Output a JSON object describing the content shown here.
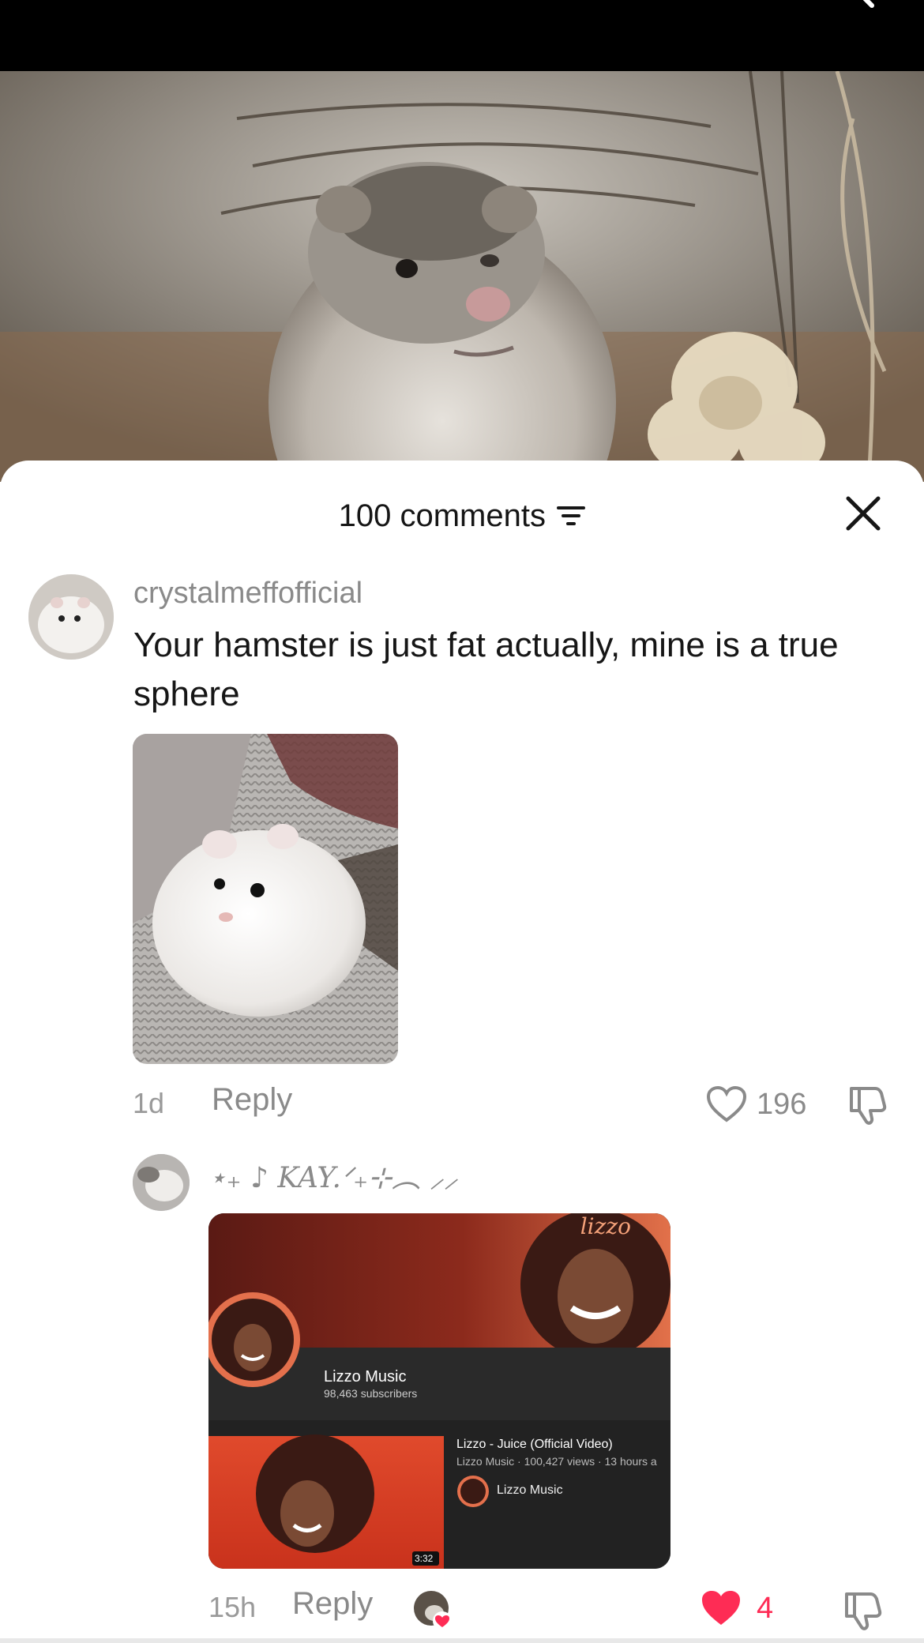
{
  "sheet": {
    "title": "100 comments"
  },
  "comments": [
    {
      "username": "crystalmeffofficial",
      "text": "Your hamster is just fat actually, mine is a true sphere",
      "time": "1d",
      "reply_label": "Reply",
      "likes": "196"
    },
    {
      "username": "⋆₊ ♪ KAY.ᐟ₊⊹︵ ⸝⸝",
      "time": "15h",
      "reply_label": "Reply",
      "likes": "4",
      "embed": {
        "brand_text": "lizzo",
        "channel_name": "Lizzo Music",
        "subscribers": "98,463 subscribers",
        "video_title": "Lizzo - Juice (Official Video)",
        "video_meta": "Lizzo Music · 100,427 views · 13 hours a",
        "video_channel": "Lizzo Music",
        "duration": "3:32"
      }
    }
  ],
  "colors": {
    "like_active": "#fe2c55",
    "muted": "#8a8a8a",
    "text": "#161616"
  }
}
